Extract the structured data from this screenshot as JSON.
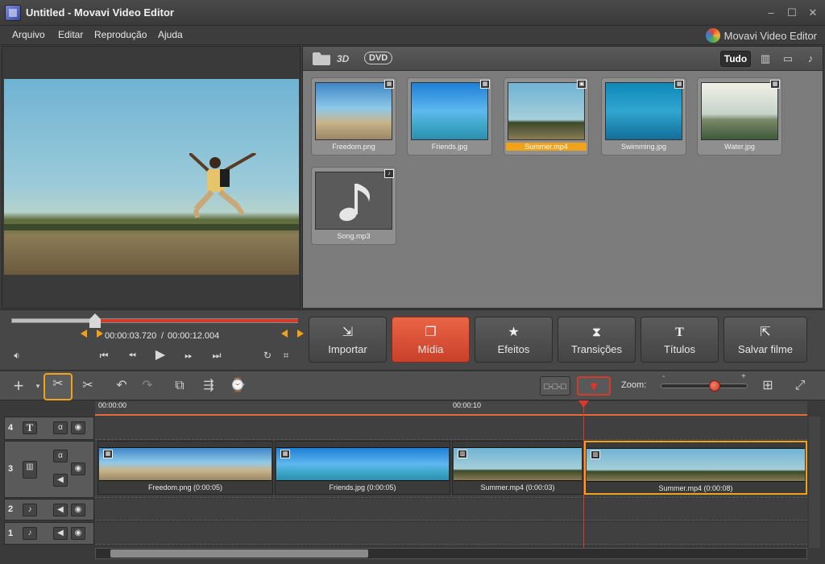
{
  "window": {
    "title": "Untitled - Movavi Video Editor",
    "minimize": "–",
    "maximize": "☐",
    "close": "✕"
  },
  "menu": [
    "Arquivo",
    "Editar",
    "Reprodução",
    "Ajuda"
  ],
  "brand": "Movavi Video Editor",
  "media_toolbar": {
    "three_d": "3D",
    "dvd": "DVD",
    "filter_all": "Tudo"
  },
  "media_items": [
    {
      "label": "Freedom.png"
    },
    {
      "label": "Friends.jpg"
    },
    {
      "label": "Summer.mp4",
      "selected": true
    },
    {
      "label": "Swimming.jpg"
    },
    {
      "label": "Water.jpg"
    },
    {
      "label": "Song.mp3"
    }
  ],
  "player": {
    "current_time": "00:00:03.720",
    "separator": "/",
    "total_time": "00:00:12.004",
    "progress": 0.31
  },
  "main_buttons": [
    {
      "label": "Importar"
    },
    {
      "label": "Mídia",
      "active": true
    },
    {
      "label": "Efeitos"
    },
    {
      "label": "Transições"
    },
    {
      "label": "Títulos"
    },
    {
      "label": "Salvar filme"
    }
  ],
  "zoom": {
    "label": "Zoom:",
    "minus": "-",
    "plus": "+",
    "level": 0.6
  },
  "ruler": {
    "t0": "00:00:00",
    "t1": "00:00:10"
  },
  "tracks": [
    {
      "num": "4"
    },
    {
      "num": "3"
    },
    {
      "num": "2"
    },
    {
      "num": "1"
    }
  ],
  "clips": [
    {
      "label": "Freedom.png (0:00:05)"
    },
    {
      "label": "Friends.jpg (0:00:05)"
    },
    {
      "label": "Summer.mp4 (0:00:03)"
    },
    {
      "label": "Summer.mp4 (0:00:08)",
      "selected": true
    }
  ],
  "colors": {
    "accent": "#f0a21a",
    "active_button": "#d9513a",
    "playhead": "#e0352b"
  }
}
